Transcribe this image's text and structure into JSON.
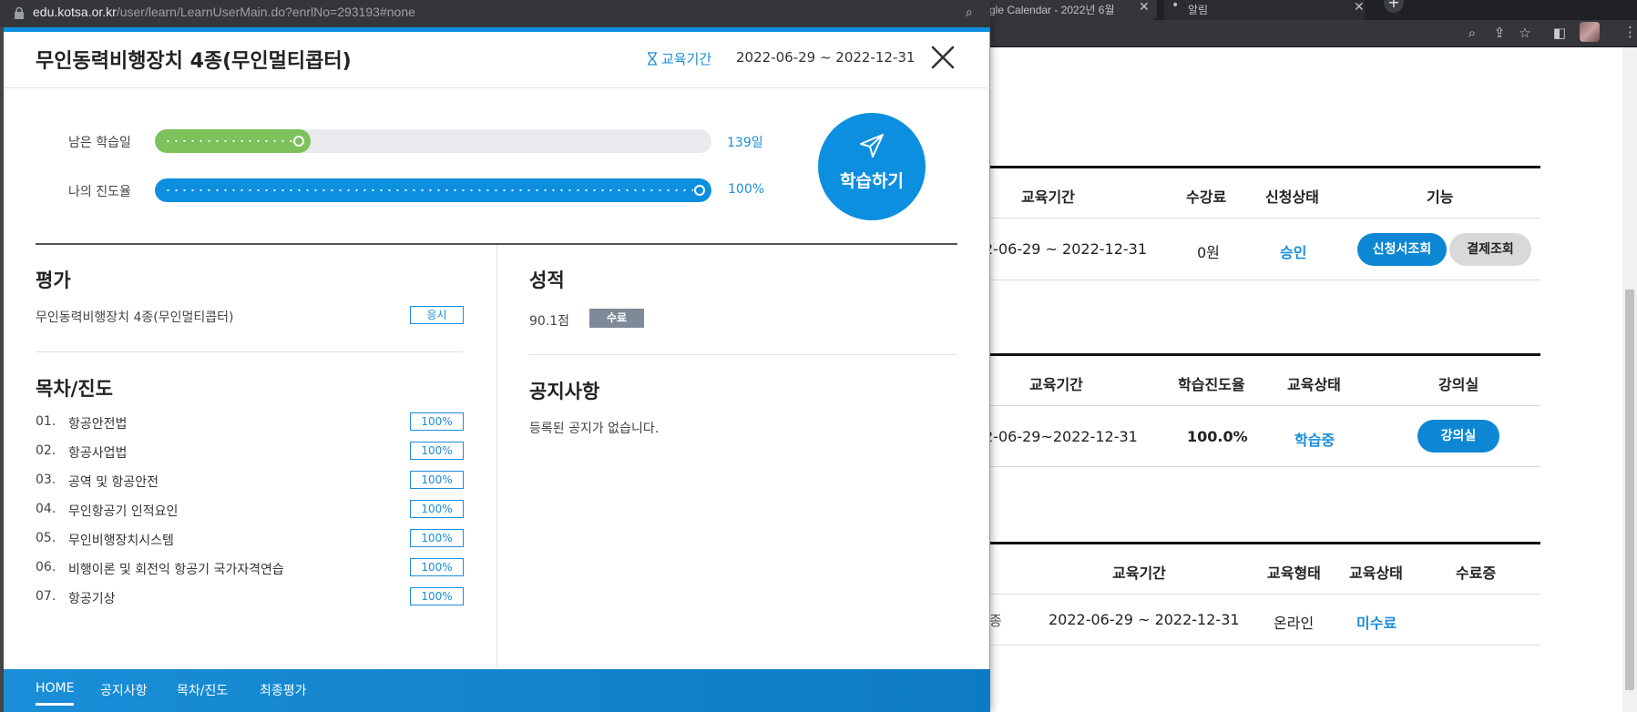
{
  "background_window": {
    "tab1_title": "gle Calendar - 2022년 6월",
    "tab2_title": "알림",
    "table1": {
      "headers": [
        "교육기간",
        "수강료",
        "신청상태",
        "기능"
      ],
      "row": {
        "period": "2-06-29 ~ 2022-12-31",
        "fee": "0원",
        "status": "승인",
        "btn1": "신청서조회",
        "btn2": "결제조회"
      }
    },
    "table2": {
      "headers": [
        "교육기간",
        "학습진도율",
        "교육상태",
        "강의실"
      ],
      "row": {
        "period": "2-06-29~2022-12-31",
        "progress": "100.0%",
        "status": "학습중",
        "btn": "강의실"
      }
    },
    "table3": {
      "headers": [
        "교육기간",
        "교육형태",
        "교육상태",
        "수료증"
      ],
      "row": {
        "lead": "종",
        "period": "2022-06-29 ~ 2022-12-31",
        "type": "온라인",
        "status": "미수료"
      }
    }
  },
  "popup": {
    "url_host": "edu.kotsa.or.kr",
    "url_path": "/user/learn/LearnUserMain.do?enrlNo=293193#none",
    "course_title": "무인동력비행장치 4종(무인멀티콥터)",
    "period_label": "교육기간",
    "period_value": "2022-06-29 ~ 2022-12-31",
    "progress": {
      "remaining_label": "남은 학습일",
      "remaining_value": "139일",
      "remaining_fraction": 0.28,
      "my_progress_label": "나의 진도율",
      "my_progress_value": "100%",
      "my_progress_fraction": 1.0
    },
    "study_button_label": "학습하기",
    "evaluation": {
      "title": "평가",
      "item_label": "무인동력비행장치 4종(무인멀티콥터)",
      "item_button": "응시"
    },
    "grade": {
      "title": "성적",
      "score": "90.1점",
      "badge": "수료"
    },
    "toc": {
      "title": "목차/진도",
      "items": [
        {
          "num": "01.",
          "label": "항공안전법",
          "pct": "100%"
        },
        {
          "num": "02.",
          "label": "항공사업법",
          "pct": "100%"
        },
        {
          "num": "03.",
          "label": "공역 및 항공안전",
          "pct": "100%"
        },
        {
          "num": "04.",
          "label": "무인항공기 인적요인",
          "pct": "100%"
        },
        {
          "num": "05.",
          "label": "무인비행장치시스템",
          "pct": "100%"
        },
        {
          "num": "06.",
          "label": "비행이론 및 회전익 항공기 국가자격연습",
          "pct": "100%"
        },
        {
          "num": "07.",
          "label": "항공기상",
          "pct": "100%"
        }
      ]
    },
    "notice": {
      "title": "공지사항",
      "empty_text": "등록된 공지가 없습니다."
    },
    "bottom_nav": [
      "HOME",
      "공지사항",
      "목차/진도",
      "최종평가"
    ]
  },
  "colors": {
    "accent": "#0d8fe0",
    "green": "#7cc15a",
    "badge_gray": "#7f8a99"
  }
}
